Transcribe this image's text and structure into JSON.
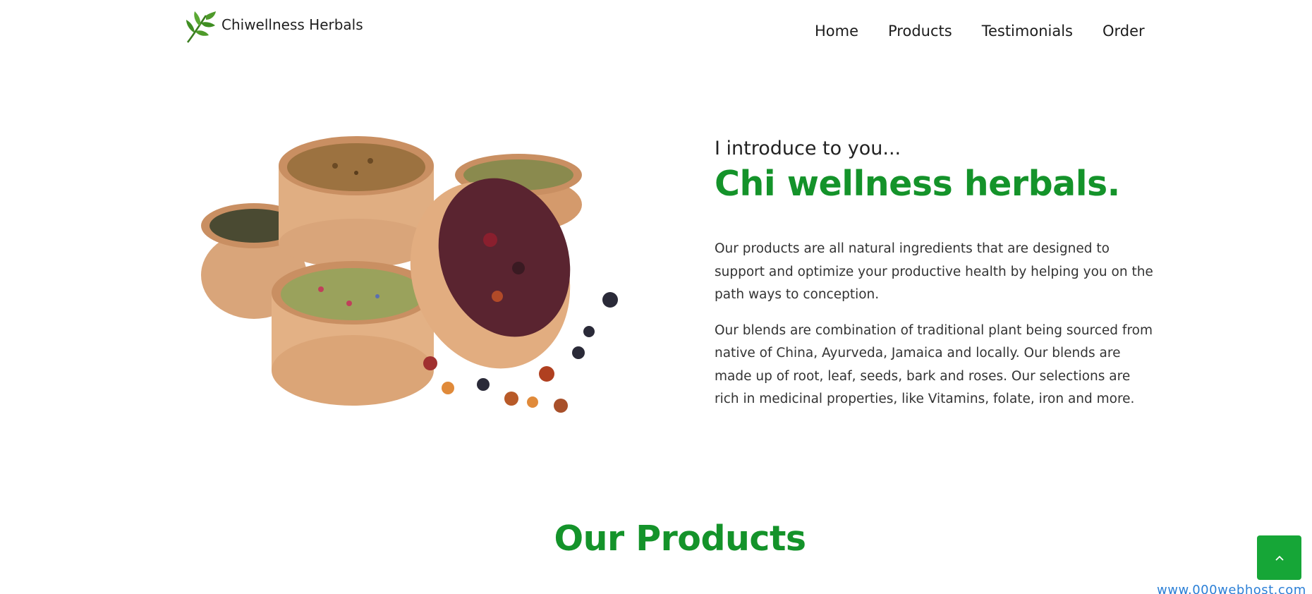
{
  "brand": {
    "name": "Chiwellness Herbals",
    "logo_icon": "leaf-sprig-icon"
  },
  "nav": {
    "items": [
      "Home",
      "Products",
      "Testimonials",
      "Order"
    ]
  },
  "hero": {
    "intro": "I introduce to you...",
    "headline": "Chi wellness herbals.",
    "paragraphs": [
      "Our products are all natural ingredients that are designed to support and optimize your productive health by helping you on the path ways to conception.",
      "Our blends are combination of traditional plant being sourced from native of China, Ayurveda, Jamaica and locally. Our blends are made up of root, leaf, seeds, bark and roses. Our selections are rich in medicinal properties, like Vitamins, folate, iron and more."
    ]
  },
  "products_section": {
    "title": "Our Products"
  },
  "back_to_top": {
    "icon": "chevron-up-icon"
  },
  "watermark": {
    "text": "www.000webhost.com"
  },
  "colors": {
    "accent_green": "#14932a",
    "button_green": "#16a637"
  }
}
